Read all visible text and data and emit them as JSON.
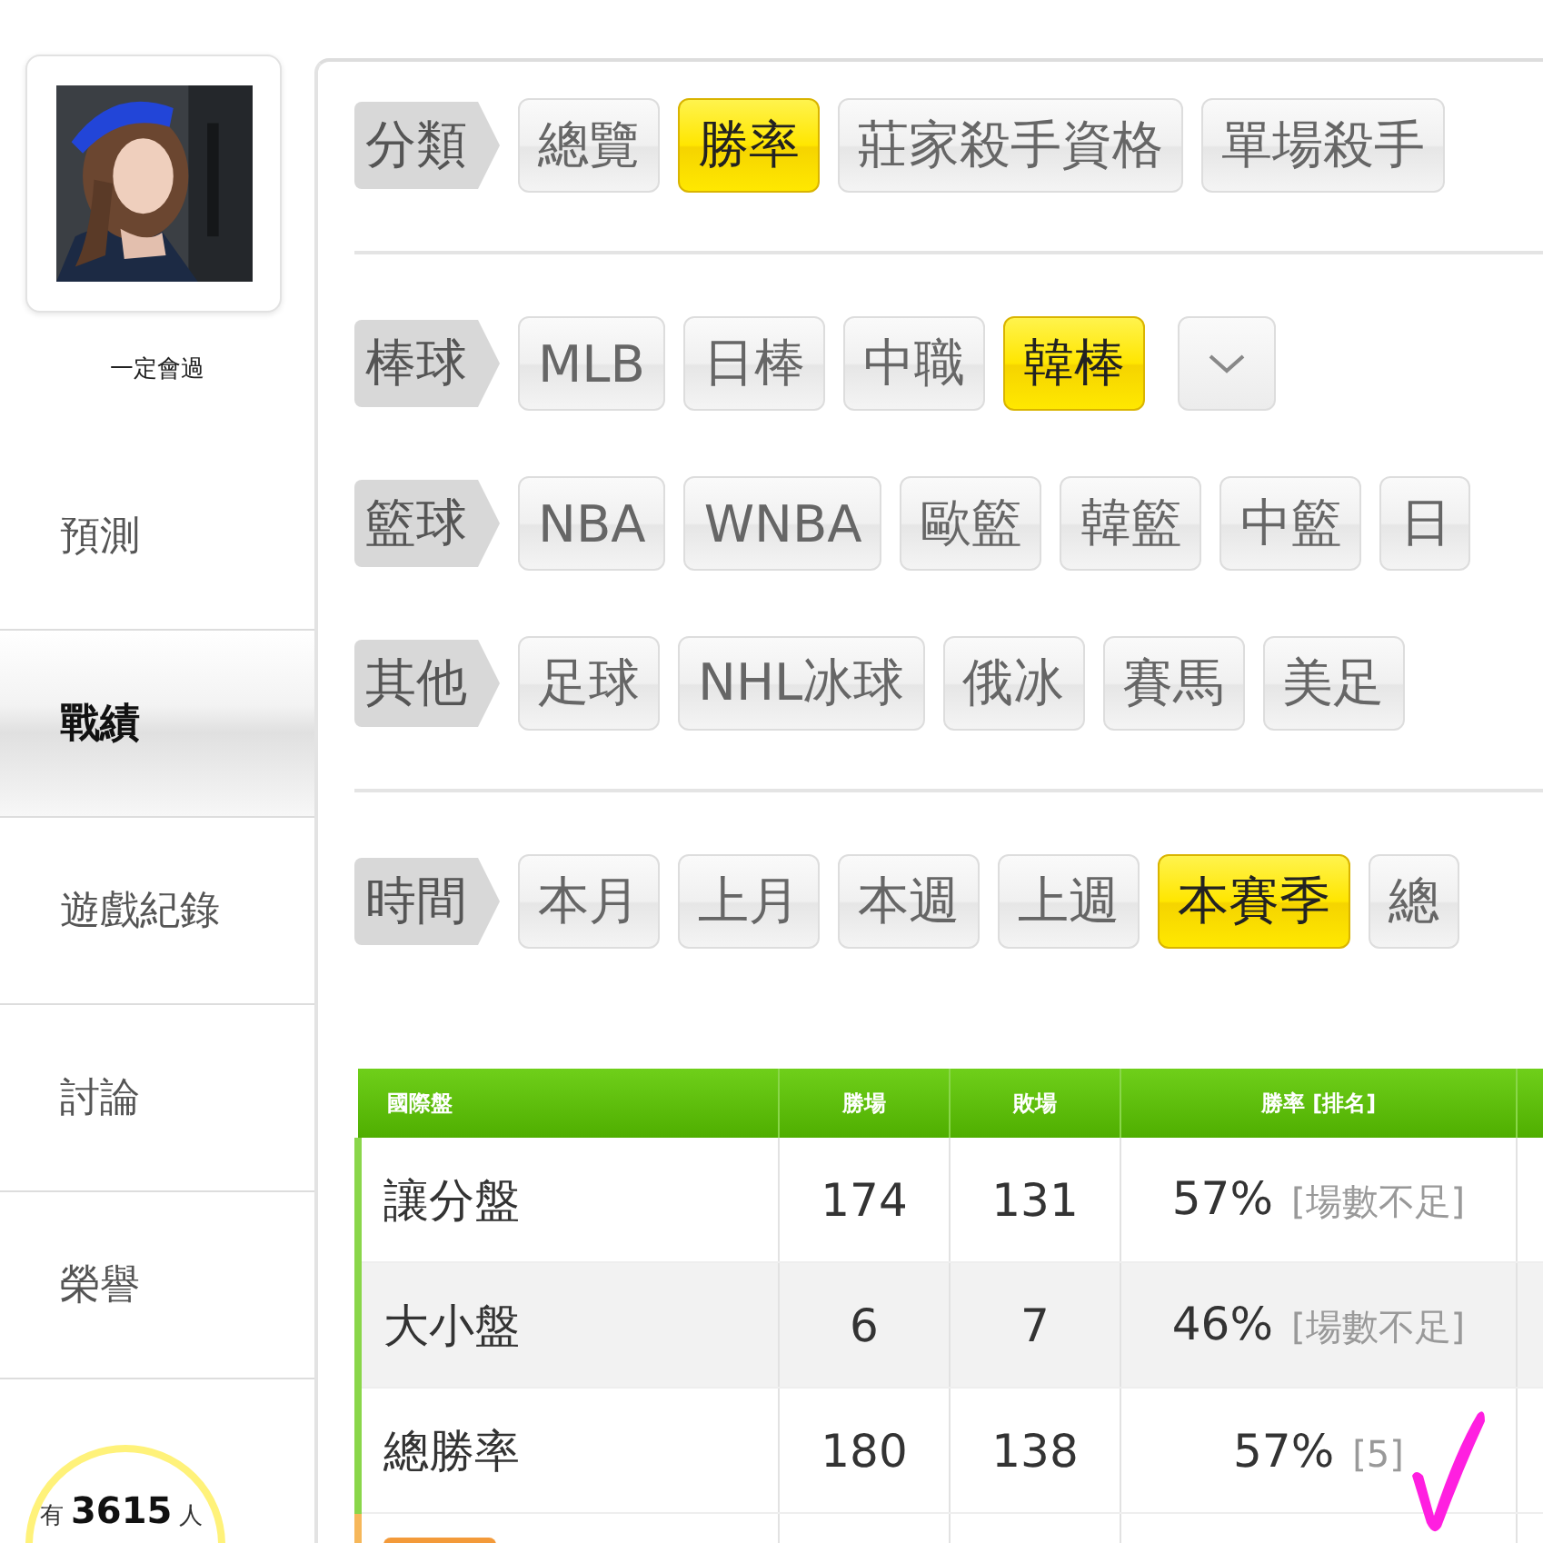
{
  "profile": {
    "username": "一定會過"
  },
  "nav": [
    {
      "label": "預測",
      "selected": false
    },
    {
      "label": "戰績",
      "selected": true
    },
    {
      "label": "遊戲紀錄",
      "selected": false
    },
    {
      "label": "討論",
      "selected": false
    },
    {
      "label": "榮譽",
      "selected": false
    }
  ],
  "followers": {
    "prefix": "有",
    "count": "3615",
    "suffix": "人"
  },
  "filter_groups": [
    {
      "rows": [
        {
          "label": "分類",
          "more_button": false,
          "options": [
            {
              "label": "總覽",
              "selected": false
            },
            {
              "label": "勝率",
              "selected": true
            },
            {
              "label": "莊家殺手資格",
              "selected": false
            },
            {
              "label": "單場殺手",
              "selected": false
            }
          ]
        }
      ]
    },
    {
      "rows": [
        {
          "label": "棒球",
          "more_button": true,
          "options": [
            {
              "label": "MLB",
              "selected": false
            },
            {
              "label": "日棒",
              "selected": false
            },
            {
              "label": "中職",
              "selected": false
            },
            {
              "label": "韓棒",
              "selected": true
            }
          ]
        },
        {
          "label": "籃球",
          "more_button": false,
          "options": [
            {
              "label": "NBA",
              "selected": false
            },
            {
              "label": "WNBA",
              "selected": false
            },
            {
              "label": "歐籃",
              "selected": false
            },
            {
              "label": "韓籃",
              "selected": false
            },
            {
              "label": "中籃",
              "selected": false
            },
            {
              "label": "日",
              "selected": false
            }
          ]
        },
        {
          "label": "其他",
          "more_button": false,
          "options": [
            {
              "label": "足球",
              "selected": false
            },
            {
              "label": "NHL冰球",
              "selected": false
            },
            {
              "label": "俄冰",
              "selected": false
            },
            {
              "label": "賽馬",
              "selected": false
            },
            {
              "label": "美足",
              "selected": false
            }
          ]
        }
      ]
    },
    {
      "rows": [
        {
          "label": "時間",
          "more_button": false,
          "options": [
            {
              "label": "本月",
              "selected": false
            },
            {
              "label": "上月",
              "selected": false
            },
            {
              "label": "本週",
              "selected": false
            },
            {
              "label": "上週",
              "selected": false
            },
            {
              "label": "本賽季",
              "selected": true
            },
            {
              "label": "總",
              "selected": false
            }
          ]
        }
      ]
    }
  ],
  "table": {
    "columns": [
      "國際盤",
      "勝場",
      "敗場",
      "勝率 [排名]"
    ],
    "rows": [
      {
        "label": "讓分盤",
        "wins": "174",
        "losses": "131",
        "rate": "57%",
        "rank": "[場數不足]"
      },
      {
        "label": "大小盤",
        "wins": "6",
        "losses": "7",
        "rate": "46%",
        "rank": "[場數不足]"
      },
      {
        "label": "總勝率",
        "wins": "180",
        "losses": "138",
        "rate": "57%",
        "rank": "[5]"
      }
    ]
  }
}
